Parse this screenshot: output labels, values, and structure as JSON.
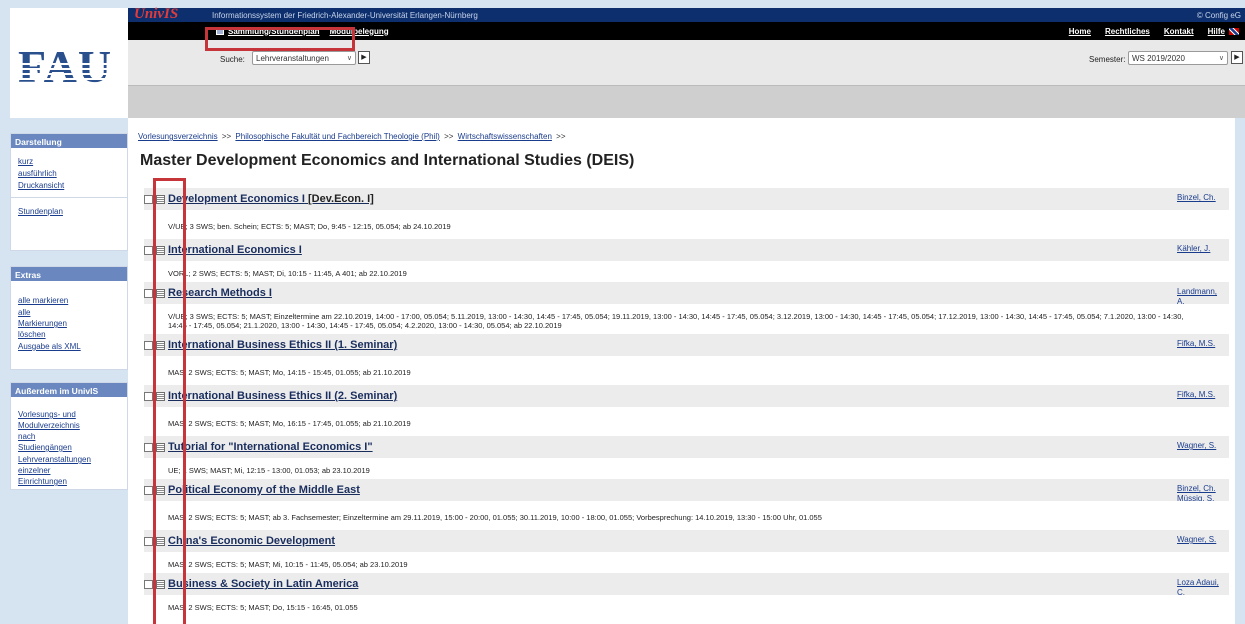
{
  "header": {
    "logo_text": "FAU",
    "brand": "UnivIS",
    "subtitle": "Informationssystem der Friedrich-Alexander-Universität Erlangen-Nürnberg",
    "config": "© Config eG",
    "nav_left": [
      "Sammlung/Stundenplan",
      "Modulbelegung"
    ],
    "nav_right": [
      "Home",
      "Rechtliches",
      "Kontakt",
      "Hilfe"
    ],
    "search_label": "Suche:",
    "search_value": "Lehrveranstaltungen",
    "semester_label": "Semester:",
    "semester_value": "WS 2019/2020"
  },
  "sidebar": {
    "darstellung": {
      "title": "Darstellung",
      "items": [
        "kurz",
        "ausführlich",
        "Druckansicht"
      ],
      "extra": "Stundenplan"
    },
    "extras": {
      "title": "Extras",
      "items": [
        "alle markieren",
        "alle Markierungen löschen",
        "Ausgabe als XML"
      ]
    },
    "ausserdem": {
      "title": "Außerdem im UnivIS",
      "items": [
        "Vorlesungs- und Modulverzeichnis nach Studiengängen",
        "Lehrveranstaltungen einzelner Einrichtungen"
      ]
    }
  },
  "breadcrumb": [
    "Vorlesungsverzeichnis",
    "Philosophische Fakultät und Fachbereich Theologie (Phil)",
    "Wirtschaftswissenschaften"
  ],
  "breadcrumb_sep": ">>",
  "page_title": "Master Development Economics and International Studies (DEIS)",
  "courses": [
    {
      "title": "Development Economics I",
      "abbr": "[Dev.Econ. I]",
      "lecturer": "Binzel, Ch.",
      "details": "V/UE; 3 SWS; ben. Schein; ECTS: 5; MAST; Do, 9:45 - 12:15, 05.054; ab 24.10.2019"
    },
    {
      "title": "International Economics I",
      "abbr": "",
      "lecturer": "Kähler, J.",
      "details": "VORL; 2 SWS; ECTS: 5; MAST; Di, 10:15 - 11:45, A 401; ab 22.10.2019"
    },
    {
      "title": "Research Methods I",
      "abbr": "",
      "lecturer": "Landmann, A.",
      "details": "V/UE; 3 SWS; ECTS: 5; MAST; Einzeltermine am 22.10.2019, 14:00 - 17:00, 05.054; 5.11.2019, 13:00 - 14:30, 14:45 - 17:45, 05.054; 19.11.2019, 13:00 - 14:30, 14:45 - 17:45, 05.054; 3.12.2019, 13:00 - 14:30, 14:45 - 17:45, 05.054; 17.12.2019, 13:00 - 14:30, 14:45 - 17:45, 05.054; 7.1.2020, 13:00 - 14:30, 14:45 - 17:45, 05.054; 21.1.2020, 13:00 - 14:30, 14:45 - 17:45, 05.054; 4.2.2020, 13:00 - 14:30, 05.054; ab 22.10.2019"
    },
    {
      "title": "International Business Ethics II (1. Seminar)",
      "abbr": "",
      "lecturer": "Fifka, M.S.",
      "details": "MAS; 2 SWS; ECTS: 5; MAST; Mo, 14:15 - 15:45, 01.055; ab 21.10.2019"
    },
    {
      "title": "International Business Ethics II (2. Seminar)",
      "abbr": "",
      "lecturer": "Fifka, M.S.",
      "details": "MAS; 2 SWS; ECTS: 5; MAST; Mo, 16:15 - 17:45, 01.055; ab 21.10.2019"
    },
    {
      "title": "Tutorial for \"International Economics I\"",
      "abbr": "",
      "lecturer": "Wagner, S.",
      "details": "UE; 1 SWS; MAST; Mi, 12:15 - 13:00, 01.053; ab 23.10.2019"
    },
    {
      "title": "Political Economy of the Middle East",
      "abbr": "",
      "lecturer": "Binzel, Ch. Müssig, S.",
      "details": "MAS; 2 SWS; ECTS: 5; MAST; ab 3. Fachsemester; Einzeltermine am 29.11.2019, 15:00 - 20:00, 01.055; 30.11.2019, 10:00 - 18:00, 01.055; Vorbesprechung: 14.10.2019, 13:30 - 15:00 Uhr, 01.055"
    },
    {
      "title": "China's Economic Development",
      "abbr": "",
      "lecturer": "Wagner, S.",
      "details": "MAS; 2 SWS; ECTS: 5; MAST; Mi, 10:15 - 11:45, 05.054; ab 23.10.2019"
    },
    {
      "title": "Business & Society in Latin America",
      "abbr": "",
      "lecturer": "Loza Adaui, C.",
      "details": "MAS; 2 SWS; ECTS: 5; MAST; Do, 15:15 - 16:45, 01.055"
    }
  ],
  "colors": {
    "nav_bg": "#000000",
    "top_bg": "#0d2f6e",
    "side_head": "#6a88bf",
    "highlight": "#c6353a"
  }
}
